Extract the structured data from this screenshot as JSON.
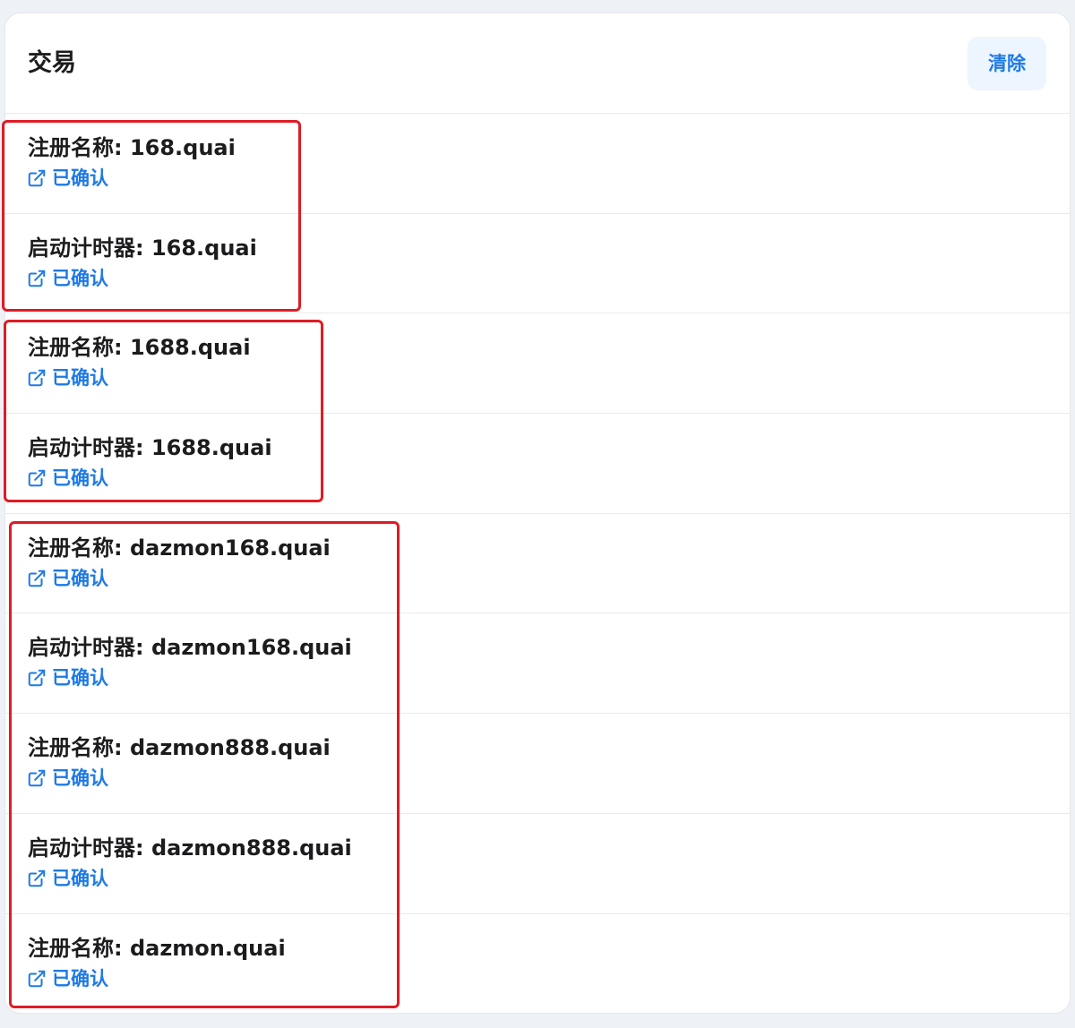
{
  "header": {
    "title": "交易",
    "clear_label": "清除"
  },
  "transactions": [
    {
      "title": "注册名称: 168.quai",
      "status": "已确认"
    },
    {
      "title": "启动计时器: 168.quai",
      "status": "已确认"
    },
    {
      "title": "注册名称: 1688.quai",
      "status": "已确认"
    },
    {
      "title": "启动计时器: 1688.quai",
      "status": "已确认"
    },
    {
      "title": "注册名称: dazmon168.quai",
      "status": "已确认"
    },
    {
      "title": "启动计时器: dazmon168.quai",
      "status": "已确认"
    },
    {
      "title": "注册名称: dazmon888.quai",
      "status": "已确认"
    },
    {
      "title": "启动计时器: dazmon888.quai",
      "status": "已确认"
    },
    {
      "title": "注册名称: dazmon.quai",
      "status": "已确认"
    }
  ],
  "colors": {
    "accent": "#1e7ae6",
    "highlight": "#e01b24",
    "clear_button_bg": "#edf5ff"
  },
  "icons": {
    "status_link": "external-link-icon"
  }
}
